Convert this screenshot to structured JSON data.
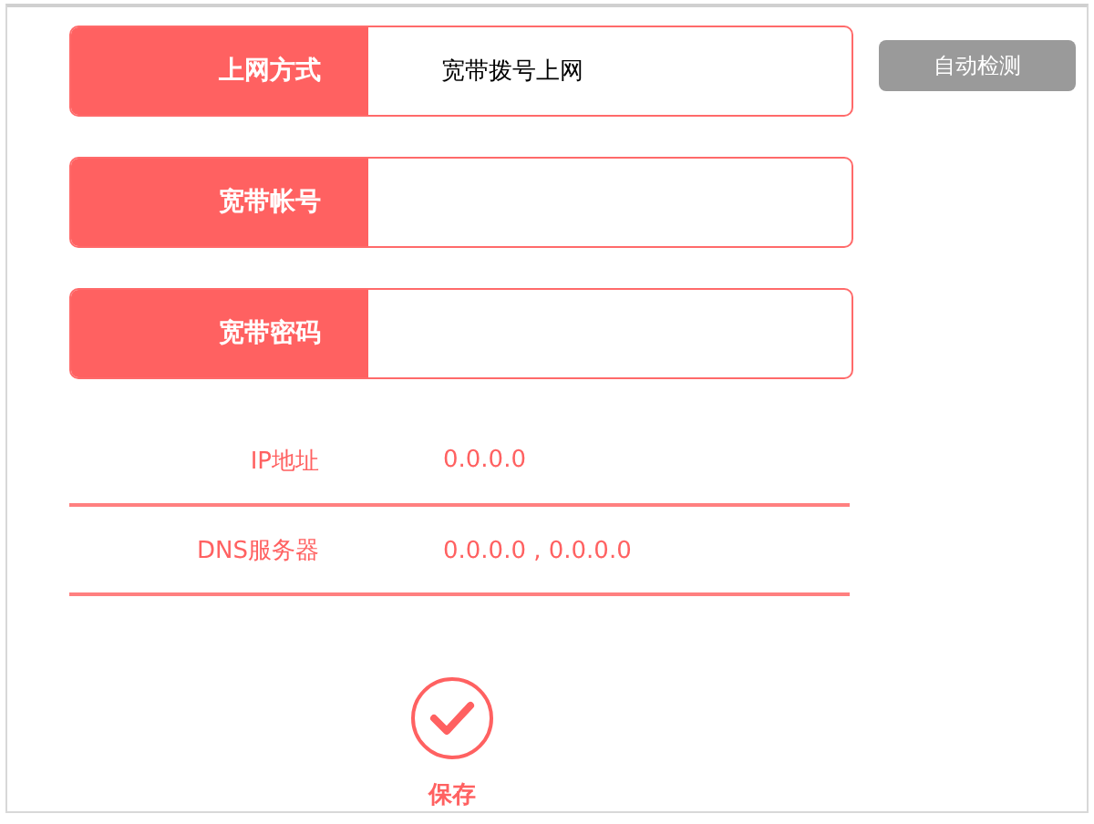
{
  "fields": [
    {
      "label": "上网方式",
      "value": "宽带拨号上网"
    },
    {
      "label": "宽带帐号"
    },
    {
      "label": "宽带密码"
    }
  ],
  "detect_button": {
    "label": "自动检测"
  },
  "info_rows": [
    {
      "label": "IP地址",
      "value": "0.0.0.0"
    },
    {
      "label": "DNS服务器",
      "value": "0.0.0.0 , 0.0.0.0"
    }
  ],
  "save_button": {
    "label": "保存"
  }
}
